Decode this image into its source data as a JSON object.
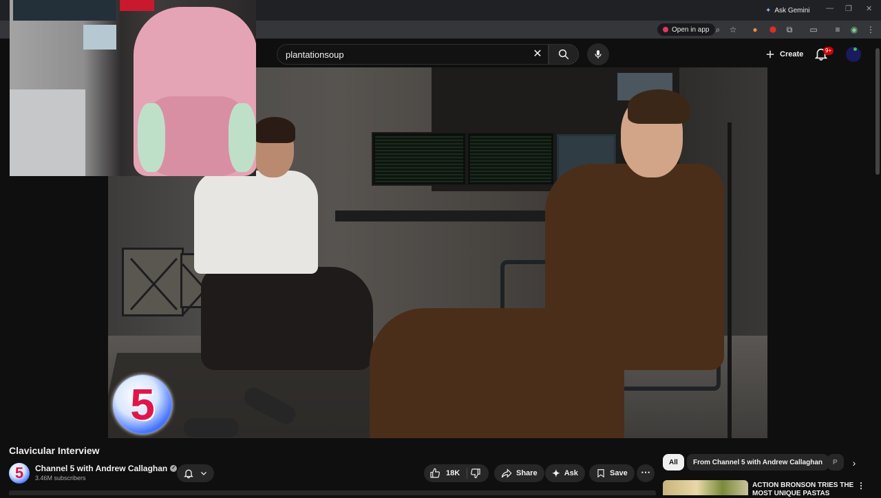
{
  "browser": {
    "gemini_label": "Ask Gemini",
    "open_in_app_label": "Open in app"
  },
  "header": {
    "search_value": "plantationsoup",
    "create_label": "Create",
    "notifications_badge": "9+"
  },
  "video": {
    "title": "Clavicular Interview",
    "logo_digit": "5"
  },
  "channel": {
    "avatar_digit": "5",
    "name": "Channel 5 with Andrew Callaghan",
    "verified_mark": "✓",
    "subscribers": "3.46M subscribers"
  },
  "actions": {
    "like_count": "18K",
    "share_label": "Share",
    "ask_label": "Ask",
    "save_label": "Save",
    "more_label": "⋯"
  },
  "sidebar": {
    "chips": [
      "All",
      "From Channel 5 with Andrew Callaghan",
      "P"
    ],
    "recommended": [
      {
        "title": "ACTION BRONSON TRIES THE MOST UNIQUE PASTAS"
      }
    ]
  },
  "colors": {
    "background": "#0f0f0f",
    "accent_red": "#cc0000",
    "pill_bg": "#272727"
  }
}
